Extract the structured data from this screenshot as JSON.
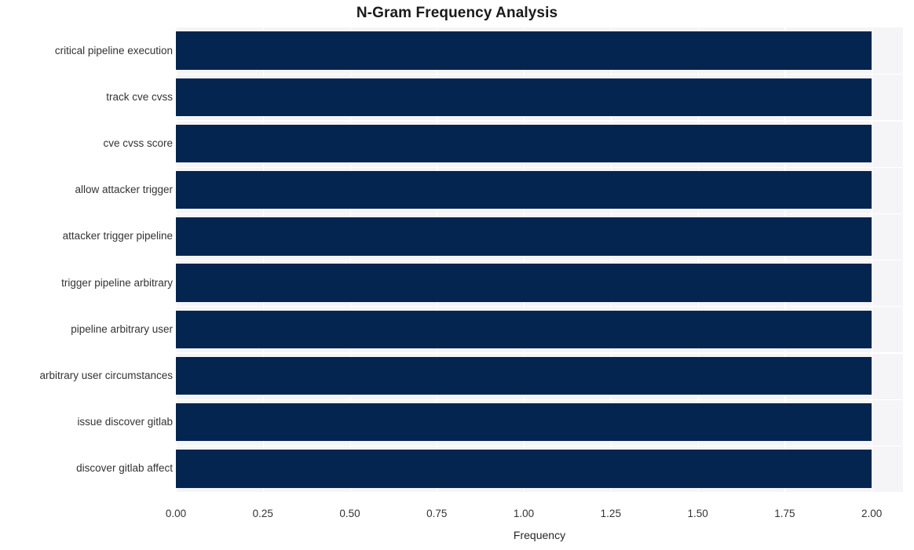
{
  "chart_data": {
    "type": "bar",
    "orientation": "horizontal",
    "title": "N-Gram Frequency Analysis",
    "xlabel": "Frequency",
    "ylabel": "",
    "categories": [
      "critical pipeline execution",
      "track cve cvss",
      "cve cvss score",
      "allow attacker trigger",
      "attacker trigger pipeline",
      "trigger pipeline arbitrary",
      "pipeline arbitrary user",
      "arbitrary user circumstances",
      "issue discover gitlab",
      "discover gitlab affect"
    ],
    "values": [
      2,
      2,
      2,
      2,
      2,
      2,
      2,
      2,
      2,
      2
    ],
    "xlim": [
      0,
      2.09
    ],
    "xticks": [
      0,
      0.25,
      0.5,
      0.75,
      1.0,
      1.25,
      1.5,
      1.75,
      2.0
    ],
    "xtick_labels": [
      "0.00",
      "0.25",
      "0.50",
      "0.75",
      "1.00",
      "1.25",
      "1.50",
      "1.75",
      "2.00"
    ],
    "grid": true,
    "legend": null,
    "colors": {
      "bar": "#04254f",
      "plot_background": "#f5f5f7",
      "figure_background": "#ffffff",
      "gridline": "#ffffff",
      "title_text": "#1a1a1a",
      "tick_text": "#333333"
    }
  }
}
